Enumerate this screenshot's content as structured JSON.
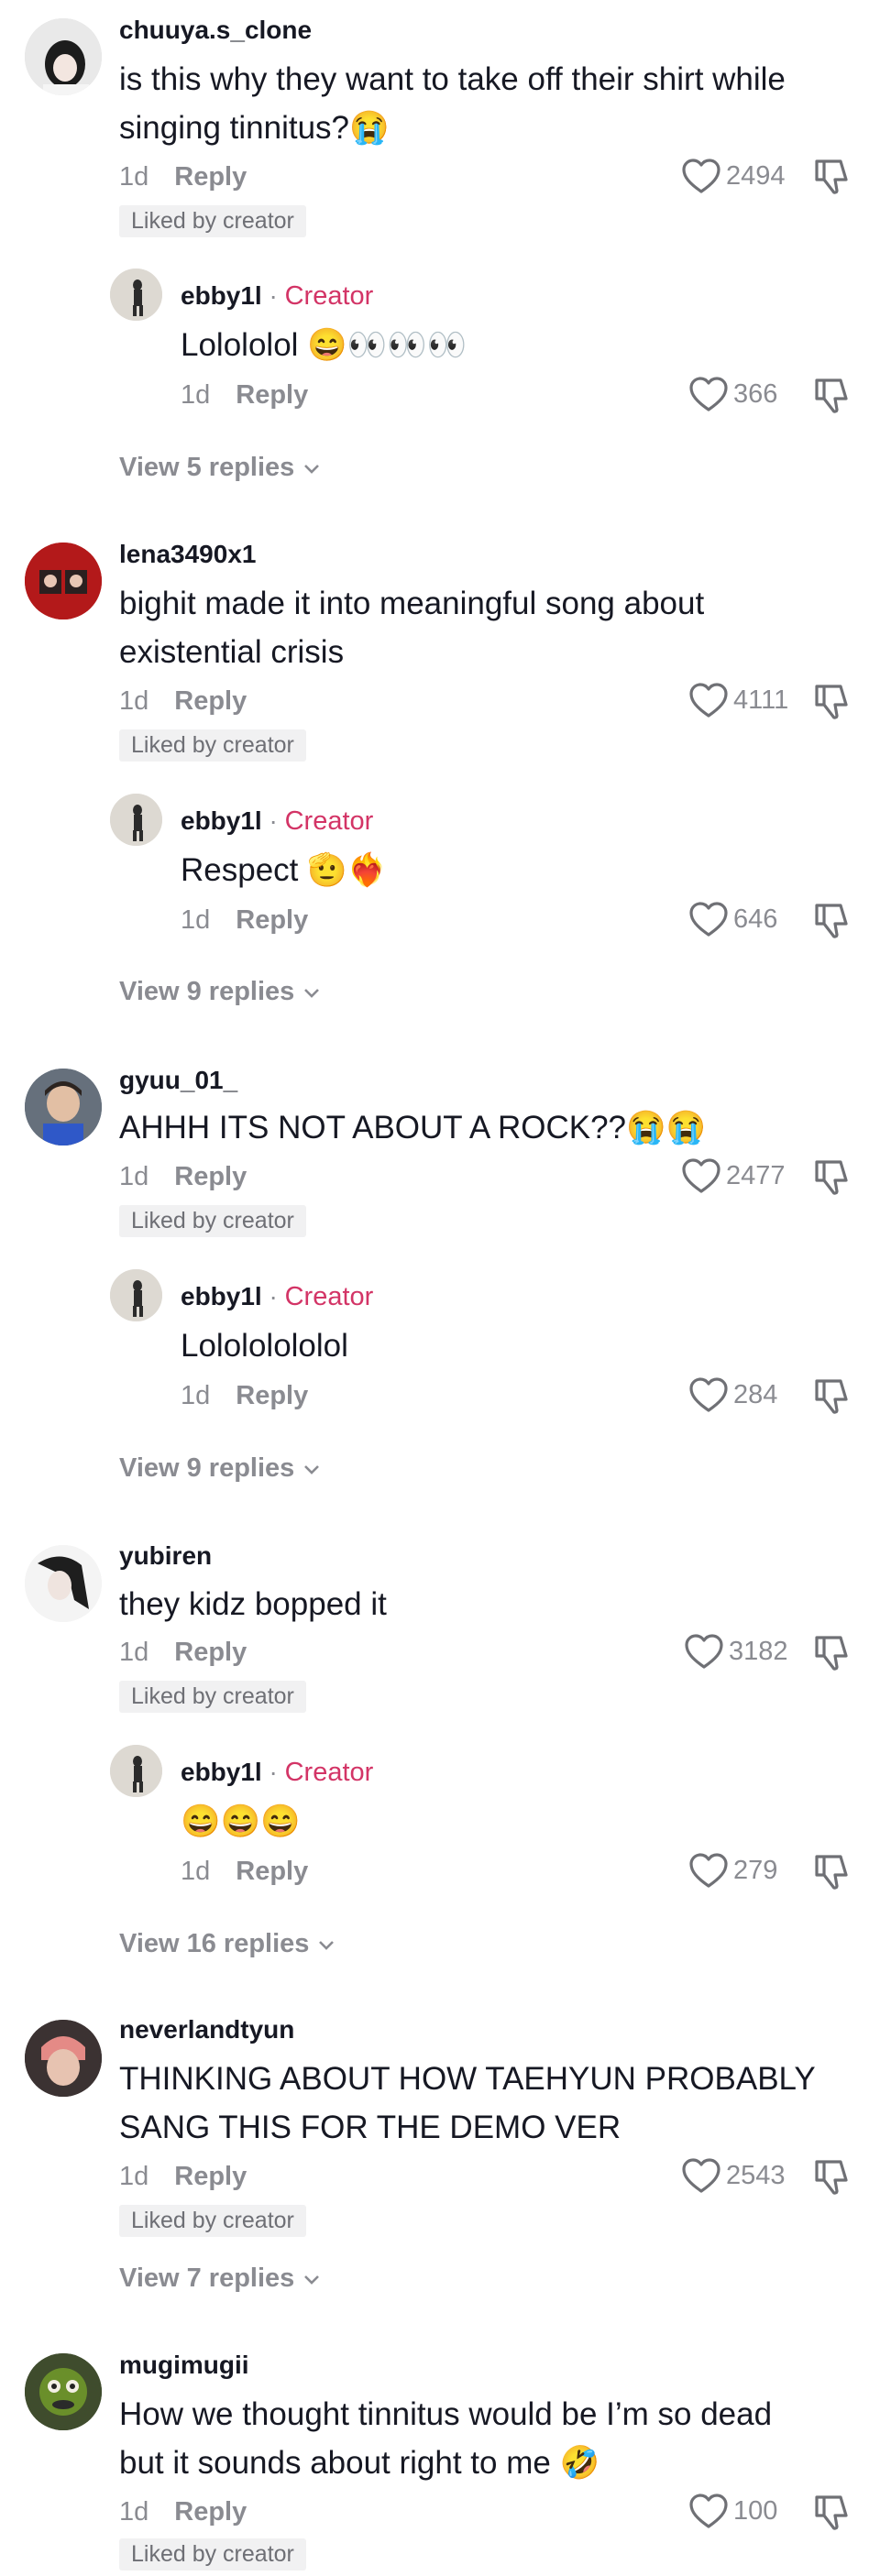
{
  "comments": [
    {
      "username": "chuuya.s_clone",
      "text": "is this why they want to take off their shirt while singing tinnitus?",
      "text_emoji": "😭",
      "age": "1d",
      "reply_label": "Reply",
      "likes": "2494",
      "liked_by": "Liked by creator",
      "reply": {
        "username": "ebby1l",
        "sep": "·",
        "role": "Creator",
        "text": "Lolololol",
        "emoji": "😄👀👀👀",
        "age": "1d",
        "reply_label": "Reply",
        "likes": "366"
      },
      "view_replies": "View 5 replies"
    },
    {
      "username": "lena3490x1",
      "text": "bighit made it into meaningful song about existential crisis",
      "text_emoji": "",
      "age": "1d",
      "reply_label": "Reply",
      "likes": "4111",
      "liked_by": "Liked by creator",
      "reply": {
        "username": "ebby1l",
        "sep": "·",
        "role": "Creator",
        "text": "Respect",
        "emoji": "🫡❤️‍🔥",
        "age": "1d",
        "reply_label": "Reply",
        "likes": "646"
      },
      "view_replies": "View 9 replies"
    },
    {
      "username": "gyuu_01_",
      "text": "AHHH ITS NOT ABOUT A ROCK??",
      "text_emoji": "😭😭",
      "age": "1d",
      "reply_label": "Reply",
      "likes": "2477",
      "liked_by": "Liked by creator",
      "reply": {
        "username": "ebby1l",
        "sep": "·",
        "role": "Creator",
        "text": "Lolololololol",
        "emoji": "",
        "age": "1d",
        "reply_label": "Reply",
        "likes": "284"
      },
      "view_replies": "View 9 replies"
    },
    {
      "username": "yubiren",
      "text": "they kidz bopped it",
      "text_emoji": "",
      "age": "1d",
      "reply_label": "Reply",
      "likes": "3182",
      "liked_by": "Liked by creator",
      "reply": {
        "username": "ebby1l",
        "sep": "·",
        "role": "Creator",
        "text": "",
        "emoji": "😄😄😄",
        "age": "1d",
        "reply_label": "Reply",
        "likes": "279"
      },
      "view_replies": "View 16 replies"
    },
    {
      "username": "neverlandtyun",
      "text": "THINKING ABOUT HOW TAEHYUN PROBABLY SANG THIS FOR THE DEMO VER",
      "text_emoji": "",
      "age": "1d",
      "reply_label": "Reply",
      "likes": "2543",
      "liked_by": "Liked by creator",
      "view_replies": "View 7 replies"
    },
    {
      "username": "mugimugii",
      "text": "How we thought tinnitus would be I’m so dead but it sounds about right to me",
      "text_emoji": "🤣",
      "age": "1d",
      "reply_label": "Reply",
      "likes": "100",
      "liked_by": "Liked by creator"
    }
  ],
  "icons": {
    "like": "heart-outline-icon",
    "dislike": "thumbs-down-icon",
    "expand": "chevron-down-icon"
  },
  "colors": {
    "creator": "#d33466",
    "muted": "#8a8b91",
    "badge_bg": "#f1f1f2"
  }
}
